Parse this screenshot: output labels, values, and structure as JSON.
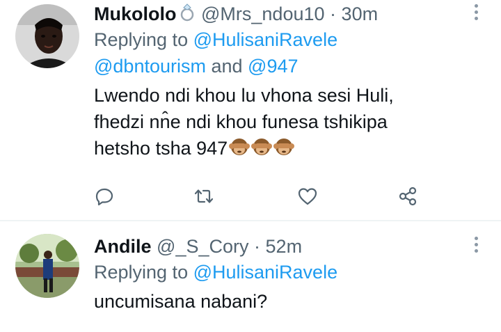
{
  "tweets": [
    {
      "name": "Mukololo",
      "handle": "@Mrs_ndou10",
      "separator": "·",
      "time": "30m",
      "replying_prefix": "Replying to ",
      "reply_to": [
        "@HulisaniRavele",
        "@dbntourism"
      ],
      "reply_and": " and ",
      "reply_last": "@947",
      "text_lines": [
        "Lwendo ndi khou lu vhona sesi Huli,",
        "fhedzi nn̂e ndi khou funesa tshikipa",
        "hetsho tsha 947"
      ],
      "emojis": [
        "see-no-evil-monkey",
        "see-no-evil-monkey",
        "see-no-evil-monkey"
      ],
      "name_badge": "ring"
    },
    {
      "name": "Andile",
      "handle": "@_S_Cory",
      "separator": "·",
      "time": "52m",
      "replying_prefix": "Replying to ",
      "reply_to": [
        "@HulisaniRavele"
      ],
      "text_lines": [
        "uncumisana nabani?"
      ]
    }
  ],
  "actions": [
    "reply-icon",
    "retweet-icon",
    "like-icon",
    "share-icon"
  ],
  "colors": {
    "link": "#1d9bf0",
    "secondary": "#536471",
    "text": "#0f1419",
    "divider": "#eff3f4"
  }
}
